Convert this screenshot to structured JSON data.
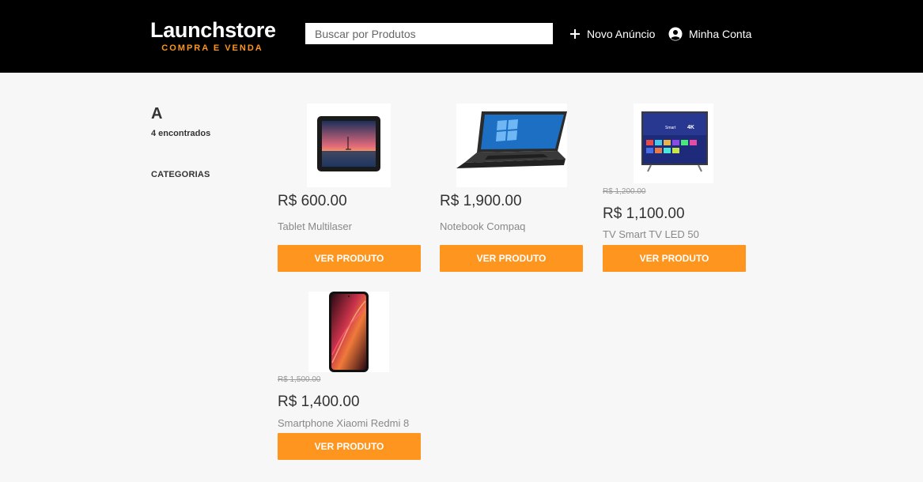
{
  "header": {
    "logo_title": "Launchstore",
    "logo_subtitle": "COMPRA E VENDA",
    "search_placeholder": "Buscar por Produtos",
    "new_ad_label": "Novo Anúncio",
    "account_label": "Minha Conta"
  },
  "sidebar": {
    "query": "A",
    "count_text": "4 encontrados",
    "categories_label": "CATEGORIAS"
  },
  "products": [
    {
      "name": "Tablet Multilaser",
      "price": "R$ 600.00",
      "old_price": "",
      "button": "VER PRODUTO",
      "image": "tablet-image"
    },
    {
      "name": "Notebook Compaq",
      "price": "R$ 1,900.00",
      "old_price": "",
      "button": "VER PRODUTO",
      "image": "laptop-image"
    },
    {
      "name": "TV Smart TV LED 50",
      "price": "R$ 1,100.00",
      "old_price": "R$ 1,200.00",
      "button": "VER PRODUTO",
      "image": "tv-image"
    },
    {
      "name": "Smartphone Xiaomi Redmi 8",
      "price": "R$ 1,400.00",
      "old_price": "R$ 1,500.00",
      "button": "VER PRODUTO",
      "image": "smartphone-image"
    }
  ],
  "colors": {
    "header_bg": "#000000",
    "accent": "#fd951f",
    "page_bg": "#f7f7f7"
  }
}
